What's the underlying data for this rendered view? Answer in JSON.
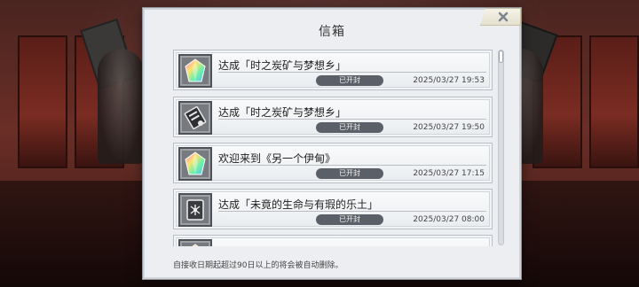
{
  "dialog": {
    "title": "信箱",
    "footer_note": "自接收日期起超过90日以上的将会被自动删除。"
  },
  "mails": [
    {
      "icon": "rainbow-crystal-icon",
      "title": "达成「时之炭矿与梦想乡」",
      "status": "已开封",
      "date": "2025/03/27 19:53"
    },
    {
      "icon": "ticket-scroll-icon",
      "title": "达成「时之炭矿与梦想乡」",
      "status": "已开封",
      "date": "2025/03/27 19:50"
    },
    {
      "icon": "rainbow-crystal-icon",
      "title": "欢迎来到《另一个伊甸》",
      "status": "已开封",
      "date": "2025/03/27 17:15"
    },
    {
      "icon": "spellbook-icon",
      "title": "达成「未竟的生命与有瑕的乐土」",
      "status": "已开封",
      "date": "2025/03/27 08:00"
    },
    {
      "icon": "rainbow-crystal-icon",
      "title": "",
      "status": "",
      "date": ""
    }
  ],
  "colors": {
    "badge": "#5b6068",
    "dialog_bg": "#eceef1",
    "accent_close": "#7f8590"
  }
}
